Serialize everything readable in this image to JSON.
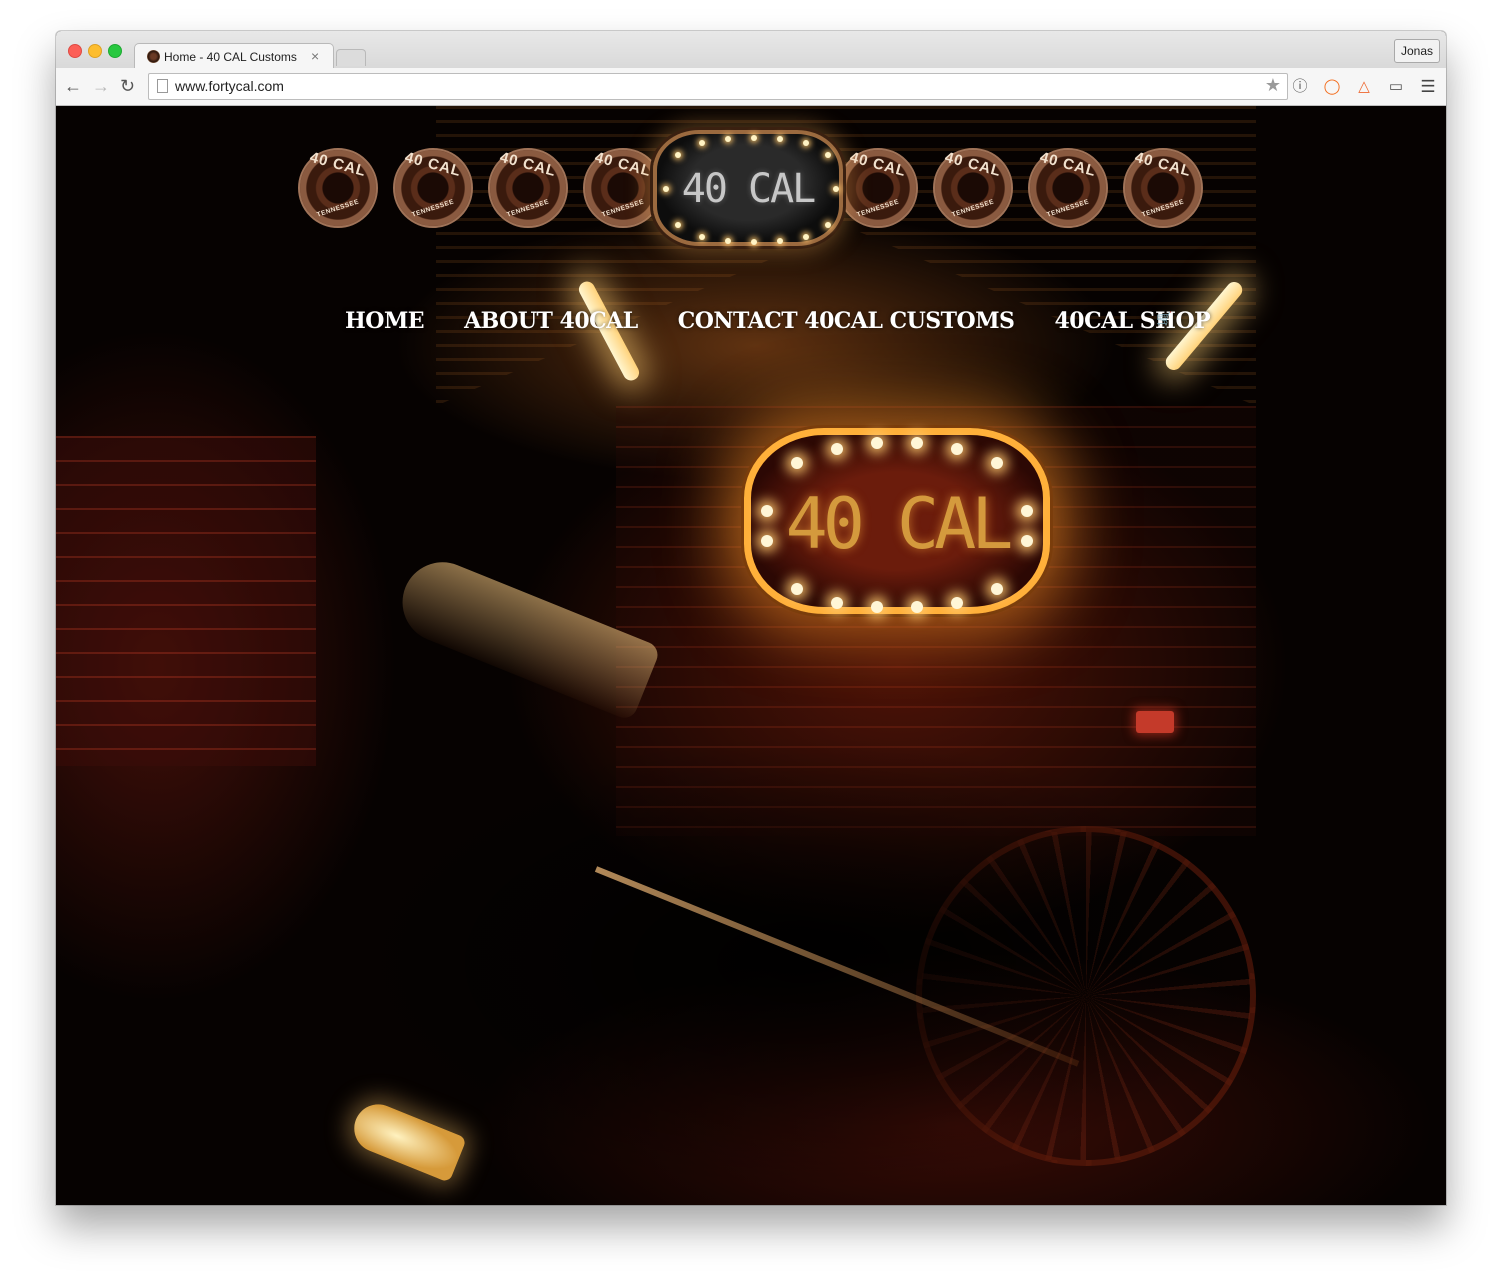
{
  "browser": {
    "tab_title": "Home - 40 CAL Customs",
    "tab_close": "×",
    "profile_name": "Jonas",
    "url": "www.fortycal.com"
  },
  "badges": [
    {
      "top": "40 CAL",
      "bottom": "TENNESSEE"
    },
    {
      "top": "40 CAL",
      "bottom": "TENNESSEE"
    },
    {
      "top": "40 CAL",
      "bottom": "TENNESSEE"
    },
    {
      "top": "40 CAL",
      "bottom": "TENNESSEE"
    },
    {
      "top": "40 CAL",
      "bottom": "TENNESSEE"
    },
    {
      "top": "40 CAL",
      "bottom": "TENNESSEE"
    },
    {
      "top": "40 CAL",
      "bottom": "TENNESSEE"
    },
    {
      "top": "40 CAL",
      "bottom": "TENNESSEE"
    }
  ],
  "logo": {
    "text": "40 CAL"
  },
  "nav": {
    "items": [
      "HOME",
      "ABOUT 40CAL",
      "CONTACT 40CAL CUSTOMS",
      "40CAL SHOP"
    ],
    "cart_icon": "cart-icon"
  },
  "hero": {
    "sign_text": "40 CAL"
  },
  "colors": {
    "nav_text": "#ffffff",
    "sign_glow": "#ffb03a",
    "badge_border": "#a07358",
    "background": "#060201"
  }
}
